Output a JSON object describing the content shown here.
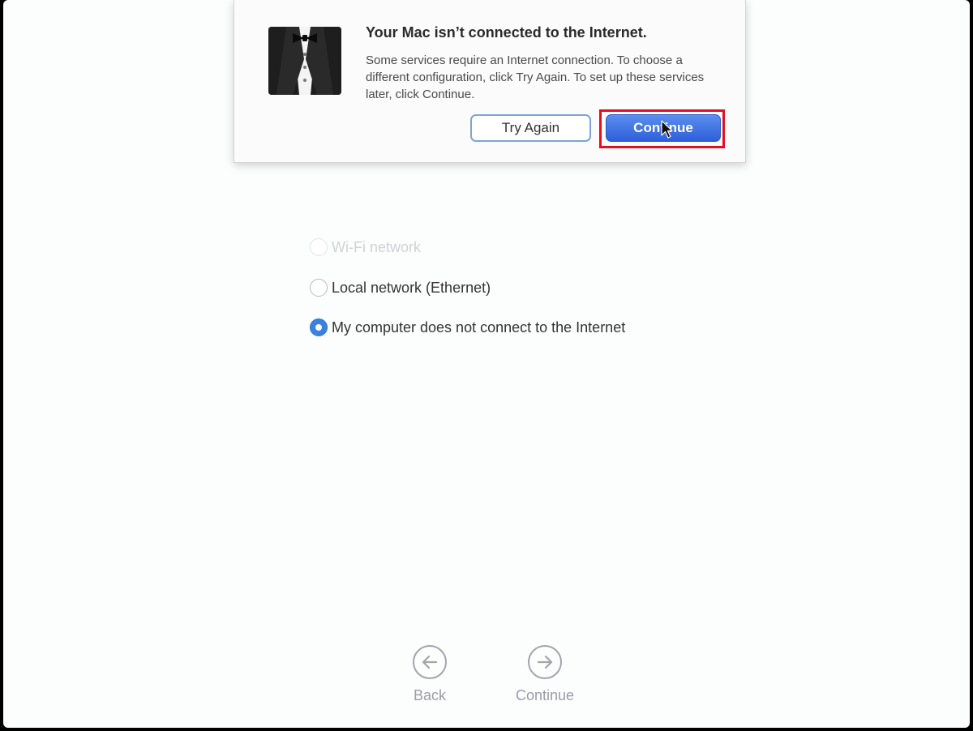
{
  "alert": {
    "title": "Your Mac isn’t connected to the Internet.",
    "message": "Some services require an Internet connection. To choose a different configuration, click Try Again. To set up these services later, click Continue.",
    "try_again_label": "Try Again",
    "continue_label": "Continue",
    "icon": "tuxedo-icon"
  },
  "options": [
    {
      "label": "Wi-Fi network",
      "selected": false,
      "enabled": false
    },
    {
      "label": "Local network (Ethernet)",
      "selected": false,
      "enabled": true
    },
    {
      "label": "My computer does not connect to the Internet",
      "selected": true,
      "enabled": true
    }
  ],
  "nav": {
    "back_label": "Back",
    "continue_label": "Continue"
  },
  "colors": {
    "accent": "#3b82e0",
    "highlight": "#e01020"
  }
}
